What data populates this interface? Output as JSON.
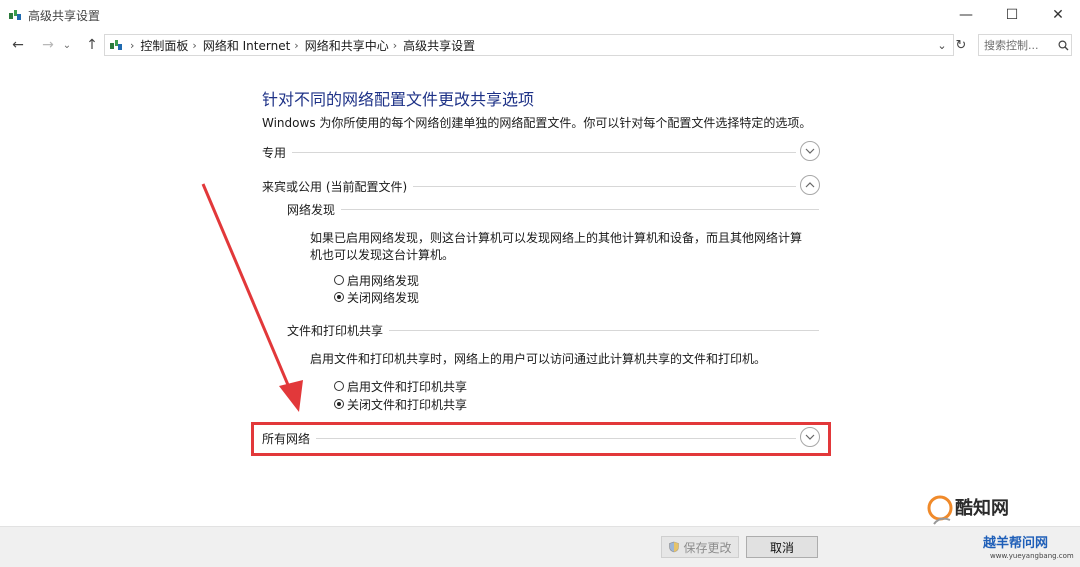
{
  "window": {
    "title": "高级共享设置",
    "controls": {
      "minimize": "—",
      "maximize": "☐",
      "close": "✕"
    }
  },
  "nav": {
    "back_icon": "arrow-left-icon",
    "forward_icon": "arrow-right-icon",
    "recent_icon": "chevron-down-icon",
    "up_icon": "arrow-up-icon"
  },
  "address": {
    "crumbs": [
      "控制面板",
      "网络和 Internet",
      "网络和共享中心",
      "高级共享设置"
    ]
  },
  "search": {
    "placeholder": "搜索控制..."
  },
  "content": {
    "heading": "针对不同的网络配置文件更改共享选项",
    "description": "Windows 为你所使用的每个网络创建单独的网络配置文件。你可以针对每个配置文件选择特定的选项。",
    "sections": {
      "private": {
        "label": "专用",
        "expanded": false
      },
      "guest": {
        "label": "来宾或公用 (当前配置文件)",
        "expanded": true
      },
      "all": {
        "label": "所有网络",
        "expanded": false
      }
    },
    "discovery": {
      "title": "网络发现",
      "desc": "如果已启用网络发现，则这台计算机可以发现网络上的其他计算机和设备，而且其他网络计算机也可以发现这台计算机。",
      "options": [
        "启用网络发现",
        "关闭网络发现"
      ],
      "selected": 1
    },
    "sharing": {
      "title": "文件和打印机共享",
      "desc": "启用文件和打印机共享时，网络上的用户可以访问通过此计算机共享的文件和打印机。",
      "options": [
        "启用文件和打印机共享",
        "关闭文件和打印机共享"
      ],
      "selected": 1
    }
  },
  "footer": {
    "save_label": "保存更改",
    "cancel_label": "取消"
  },
  "watermark": {
    "line1": "酷知网",
    "line2": "越羊帮问网",
    "line3": "www.yueyangbang.com"
  },
  "colors": {
    "heading": "#1e3287",
    "annotation": "#e2383a"
  }
}
